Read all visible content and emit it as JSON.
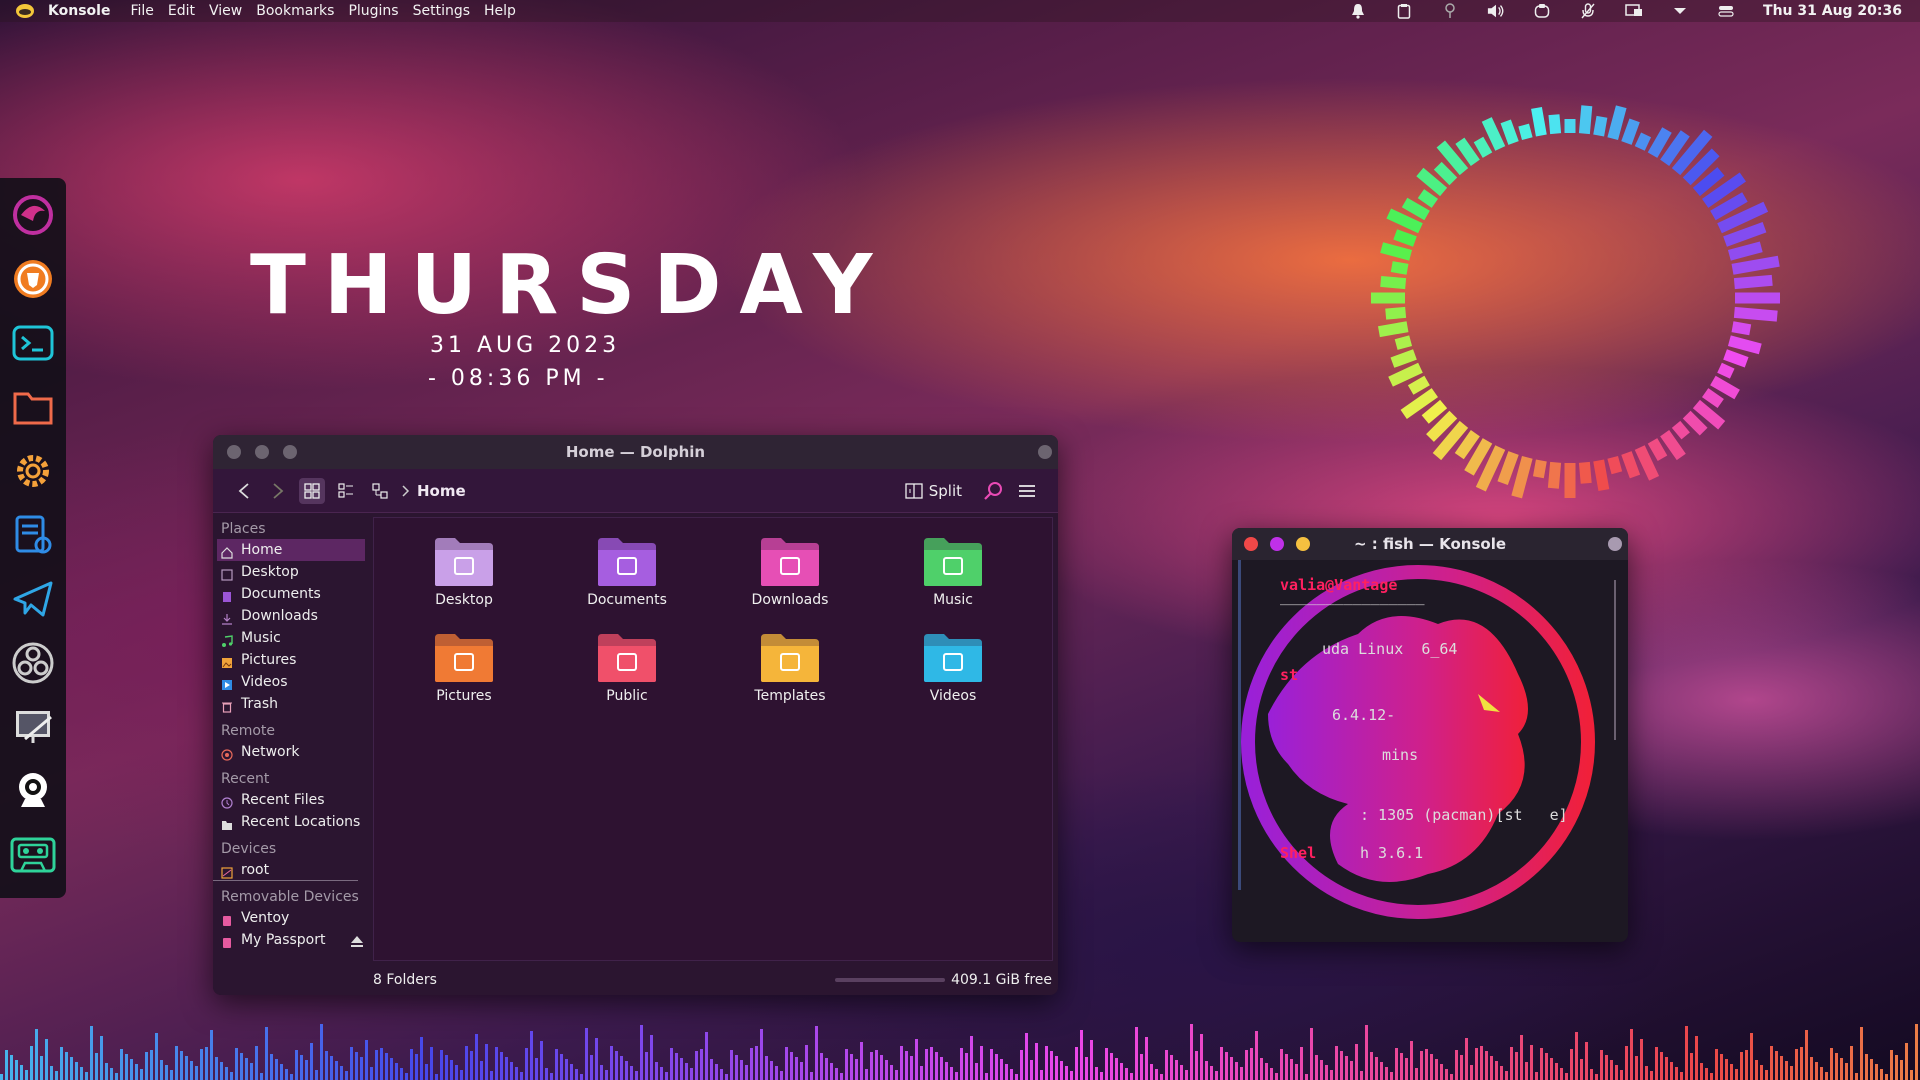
{
  "menubar": {
    "app_name": "Konsole",
    "menus": [
      "File",
      "Edit",
      "View",
      "Bookmarks",
      "Plugins",
      "Settings",
      "Help"
    ],
    "clock": "Thu 31 Aug 20:36",
    "tray_icons": [
      "bell-icon",
      "clipboard-icon",
      "location-icon",
      "volume-icon",
      "shield-icon",
      "microphone-icon",
      "display-icon",
      "chevron-down-icon",
      "toggle-icon"
    ]
  },
  "dock": {
    "apps": [
      "dragon-app-icon",
      "brave-browser-icon",
      "terminal-icon",
      "folder-icon",
      "settings-gear-icon",
      "text-editor-icon",
      "telegram-icon",
      "obs-icon",
      "screenshot-icon",
      "webcam-icon",
      "cassette-icon"
    ]
  },
  "widget": {
    "day": "THURSDAY",
    "date": "31 AUG 2023",
    "time": "- 08:36 PM -"
  },
  "dolphin": {
    "title": "Home — Dolphin",
    "breadcrumb": "Home",
    "split_label": "Split",
    "sidebar": {
      "places_header": "Places",
      "places": [
        "Home",
        "Desktop",
        "Documents",
        "Downloads",
        "Music",
        "Pictures",
        "Videos",
        "Trash"
      ],
      "remote_header": "Remote",
      "remote": [
        "Network"
      ],
      "recent_header": "Recent",
      "recent": [
        "Recent Files",
        "Recent Locations"
      ],
      "devices_header": "Devices",
      "devices": [
        "root"
      ],
      "removable_header": "Removable Devices",
      "removable": [
        "Ventoy",
        "My Passport"
      ]
    },
    "folders": [
      "Desktop",
      "Documents",
      "Downloads",
      "Music",
      "Pictures",
      "Public",
      "Templates",
      "Videos"
    ],
    "status_left": "8 Folders",
    "status_right": "409.1 GiB free",
    "colors": {
      "desktop": "#c9a0e8",
      "documents": "#a65ee0",
      "downloads": "#e64fb5",
      "music": "#4fd06a",
      "pictures": "#f07a34",
      "public": "#f0506a",
      "templates": "#f5b53a",
      "videos": "#2fb8e6"
    }
  },
  "konsole": {
    "title": "~ : fish — Konsole",
    "lines": {
      "prompt_user": "valia",
      "prompt_host": "@Vantage",
      "separator": "‾‾‾‾‾‾‾‾‾‾‾‾‾‾‾‾",
      "os": "uda Linux  6_64",
      "host_label": "st",
      "kernel": "6.4.12-",
      "uptime": "mins",
      "packages": ": 1305 (pacman)[st   e]",
      "shell_label": "Shel",
      "shell_val": "h 3.6.1"
    }
  }
}
